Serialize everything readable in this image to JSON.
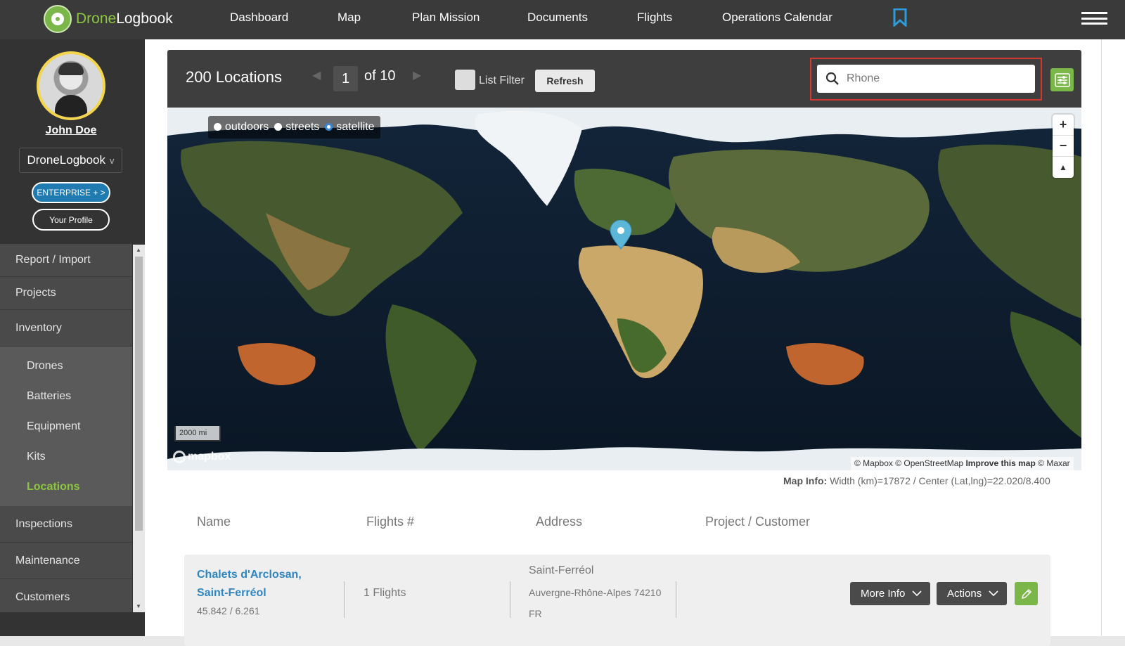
{
  "app": {
    "logo_primary": "Drone",
    "logo_secondary": "Logbook"
  },
  "nav": {
    "items": [
      "Dashboard",
      "Map",
      "Plan Mission",
      "Documents",
      "Flights",
      "Operations Calendar"
    ],
    "bookmark_icon": "bookmark-icon",
    "menu_icon": "hamburger-icon"
  },
  "user": {
    "name": "John Doe",
    "org": "DroneLogbook",
    "org_chevron": "v",
    "plan_button": "ENTERPRISE + >",
    "profile_button": "Your Profile"
  },
  "sidebar": {
    "items_top": [
      "Report / Import",
      "Projects",
      "Inventory"
    ],
    "inventory_sub": [
      "Drones",
      "Batteries",
      "Equipment",
      "Kits",
      "Locations"
    ],
    "active_sub": "Locations",
    "items_bottom": [
      "Inspections",
      "Maintenance",
      "Customers"
    ]
  },
  "toolbar": {
    "count_label": "200 Locations",
    "page": "1",
    "of_pages": "of 10",
    "list_filter_label": "List Filter",
    "refresh_label": "Refresh",
    "search_value": "Rhone"
  },
  "map": {
    "styles": [
      "outdoors",
      "streets",
      "satellite"
    ],
    "selected_style": "satellite",
    "zoom_in": "+",
    "zoom_out": "−",
    "compass": "▲",
    "scale_label": "2000 mi",
    "brand": "mapbox",
    "attribution_1": "© Mapbox © OpenStreetMap",
    "attribution_2": "Improve this map",
    "attribution_3": "© Maxar",
    "info_label": "Map Info:",
    "info_value": "Width (km)=17872 / Center (Lat,lng)=22.020/8.400",
    "accent": "#3b87d8",
    "pin_color": "#5bb6d8"
  },
  "table": {
    "headers": [
      "Name",
      "Flights #",
      "Address",
      "Project / Customer"
    ],
    "rows": [
      {
        "name_line1": "Chalets d'Arclosan,",
        "name_line2": "Saint-Ferréol",
        "coords": "45.842 / 6.261",
        "flights": "1 Flights",
        "addr_line1": "Saint-Ferréol",
        "addr_line2": "Auvergne-Rhône-Alpes 74210",
        "addr_line3": "FR",
        "project": "",
        "more_info": "More Info",
        "actions": "Actions"
      }
    ]
  },
  "colors": {
    "brand_green": "#8cc63f",
    "link_blue": "#2e86c1",
    "highlight_red": "#d3392f"
  }
}
